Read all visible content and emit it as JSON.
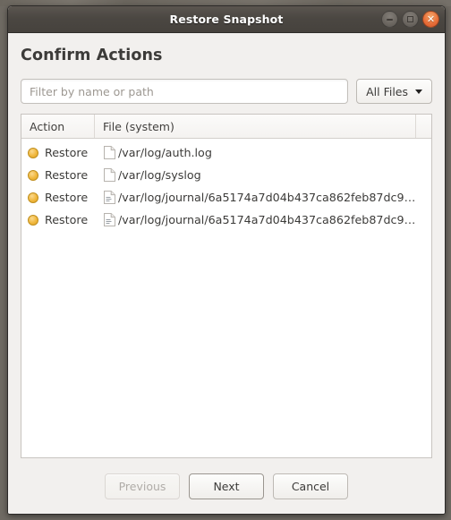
{
  "window": {
    "title": "Restore Snapshot",
    "controls": [
      {
        "name": "minimize",
        "icon": "minimize-icon"
      },
      {
        "name": "maximize",
        "icon": "maximize-icon"
      },
      {
        "name": "close",
        "icon": "close-icon",
        "color": "#e8703a"
      }
    ]
  },
  "page": {
    "heading": "Confirm Actions"
  },
  "filter": {
    "placeholder": "Filter by name or path",
    "value": "",
    "file_type_label": "All Files",
    "file_type_icon": "chevron-down-icon"
  },
  "table": {
    "columns": [
      "Action",
      "File (system)",
      ""
    ],
    "rows": [
      {
        "status_icon": "amber-dot-icon",
        "action": "Restore",
        "file_icon": "document-blank-icon",
        "path": "/var/log/auth.log"
      },
      {
        "status_icon": "amber-dot-icon",
        "action": "Restore",
        "file_icon": "document-blank-icon",
        "path": "/var/log/syslog"
      },
      {
        "status_icon": "amber-dot-icon",
        "action": "Restore",
        "file_icon": "document-text-icon",
        "path": "/var/log/journal/6a5174a7d04b437ca862feb87dc9…"
      },
      {
        "status_icon": "amber-dot-icon",
        "action": "Restore",
        "file_icon": "document-text-icon",
        "path": "/var/log/journal/6a5174a7d04b437ca862feb87dc9…"
      }
    ]
  },
  "footer": {
    "previous_label": "Previous",
    "next_label": "Next",
    "cancel_label": "Cancel"
  },
  "colors": {
    "titlebar": "#47433f",
    "dialog_bg": "#f2f0ee",
    "status_amber": "#f0b73c",
    "close_button": "#e8703a"
  }
}
